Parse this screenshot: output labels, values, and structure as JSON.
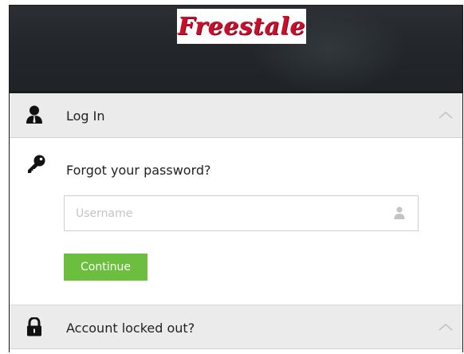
{
  "brand": {
    "logo_text": "Freestale"
  },
  "sections": {
    "login": {
      "label": "Log In",
      "icon": "user-silhouette-icon",
      "chevron": "chevron-up-icon"
    },
    "forgot": {
      "label": "Forgot your password?",
      "icon": "key-icon",
      "username_placeholder": "Username",
      "username_value": "",
      "username_icon": "user-icon",
      "continue_label": "Continue"
    },
    "locked": {
      "label": "Account locked out?",
      "icon": "padlock-icon",
      "chevron": "chevron-up-icon"
    }
  },
  "colors": {
    "accent_green": "#6cbf3e",
    "logo_red": "#c8102e",
    "header_bg": "#ebebeb"
  }
}
